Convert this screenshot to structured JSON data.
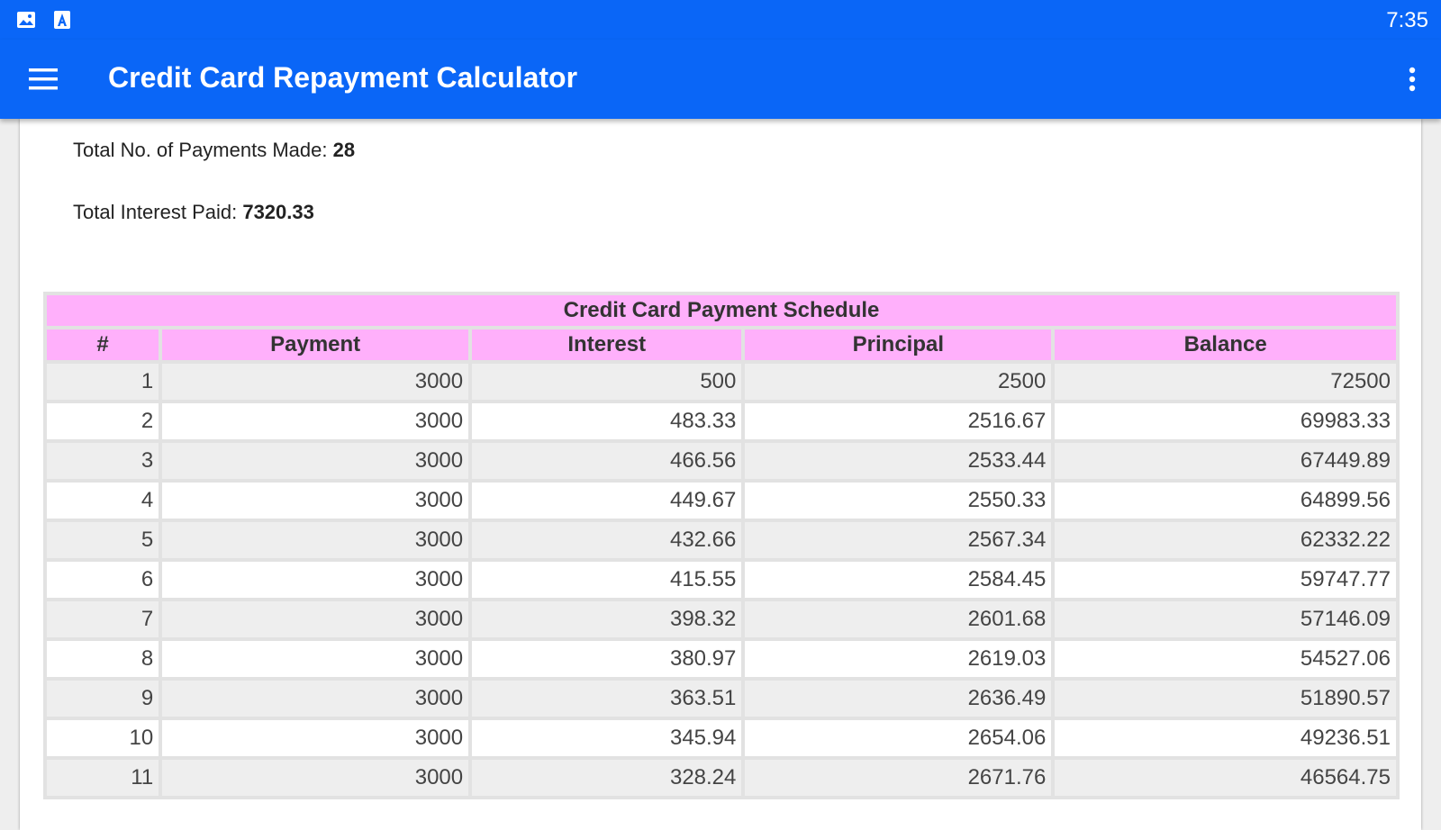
{
  "status_bar": {
    "time": "7:35",
    "icons": [
      "image-icon",
      "app-notification-icon"
    ]
  },
  "app_bar": {
    "title": "Credit Card Repayment Calculator",
    "menu_icon": "hamburger-menu-icon",
    "overflow_icon": "more-vert-icon"
  },
  "summary": {
    "payments_label": "Total No. of Payments Made: ",
    "payments_value": "28",
    "interest_label": "Total Interest Paid: ",
    "interest_value": "7320.33"
  },
  "schedule": {
    "title": "Credit Card Payment Schedule",
    "columns": [
      "#",
      "Payment",
      "Interest",
      "Principal",
      "Balance"
    ],
    "rows": [
      [
        "1",
        "3000",
        "500",
        "2500",
        "72500"
      ],
      [
        "2",
        "3000",
        "483.33",
        "2516.67",
        "69983.33"
      ],
      [
        "3",
        "3000",
        "466.56",
        "2533.44",
        "67449.89"
      ],
      [
        "4",
        "3000",
        "449.67",
        "2550.33",
        "64899.56"
      ],
      [
        "5",
        "3000",
        "432.66",
        "2567.34",
        "62332.22"
      ],
      [
        "6",
        "3000",
        "415.55",
        "2584.45",
        "59747.77"
      ],
      [
        "7",
        "3000",
        "398.32",
        "2601.68",
        "57146.09"
      ],
      [
        "8",
        "3000",
        "380.97",
        "2619.03",
        "54527.06"
      ],
      [
        "9",
        "3000",
        "363.51",
        "2636.49",
        "51890.57"
      ],
      [
        "10",
        "3000",
        "345.94",
        "2654.06",
        "49236.51"
      ],
      [
        "11",
        "3000",
        "328.24",
        "2671.76",
        "46564.75"
      ]
    ]
  },
  "colors": {
    "primary": "#0a66f7",
    "table_header": "#ffb0fb",
    "row_alt": "#eeeeee"
  }
}
